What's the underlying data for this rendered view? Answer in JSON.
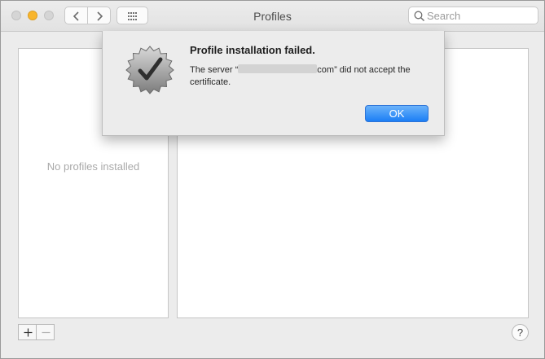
{
  "window": {
    "title": "Profiles"
  },
  "toolbar": {
    "back_icon": "chevron-left-icon",
    "forward_icon": "chevron-right-icon",
    "grid_icon": "show-all-grid-icon"
  },
  "search": {
    "placeholder": "Search",
    "value": ""
  },
  "profiles_list": {
    "empty_text": "No profiles installed"
  },
  "footer": {
    "add_label": "+",
    "remove_label": "−",
    "help_label": "?"
  },
  "alert": {
    "title": "Profile installation failed.",
    "message_prefix": "The server “",
    "message_suffix": "com” did not accept the certificate.",
    "ok_label": "OK",
    "icon": "profile-badge-checkmark-icon"
  },
  "colors": {
    "accent": "#1b7ef5",
    "traffic_minimize": "#f8b52c",
    "window_bg": "#ececec"
  }
}
